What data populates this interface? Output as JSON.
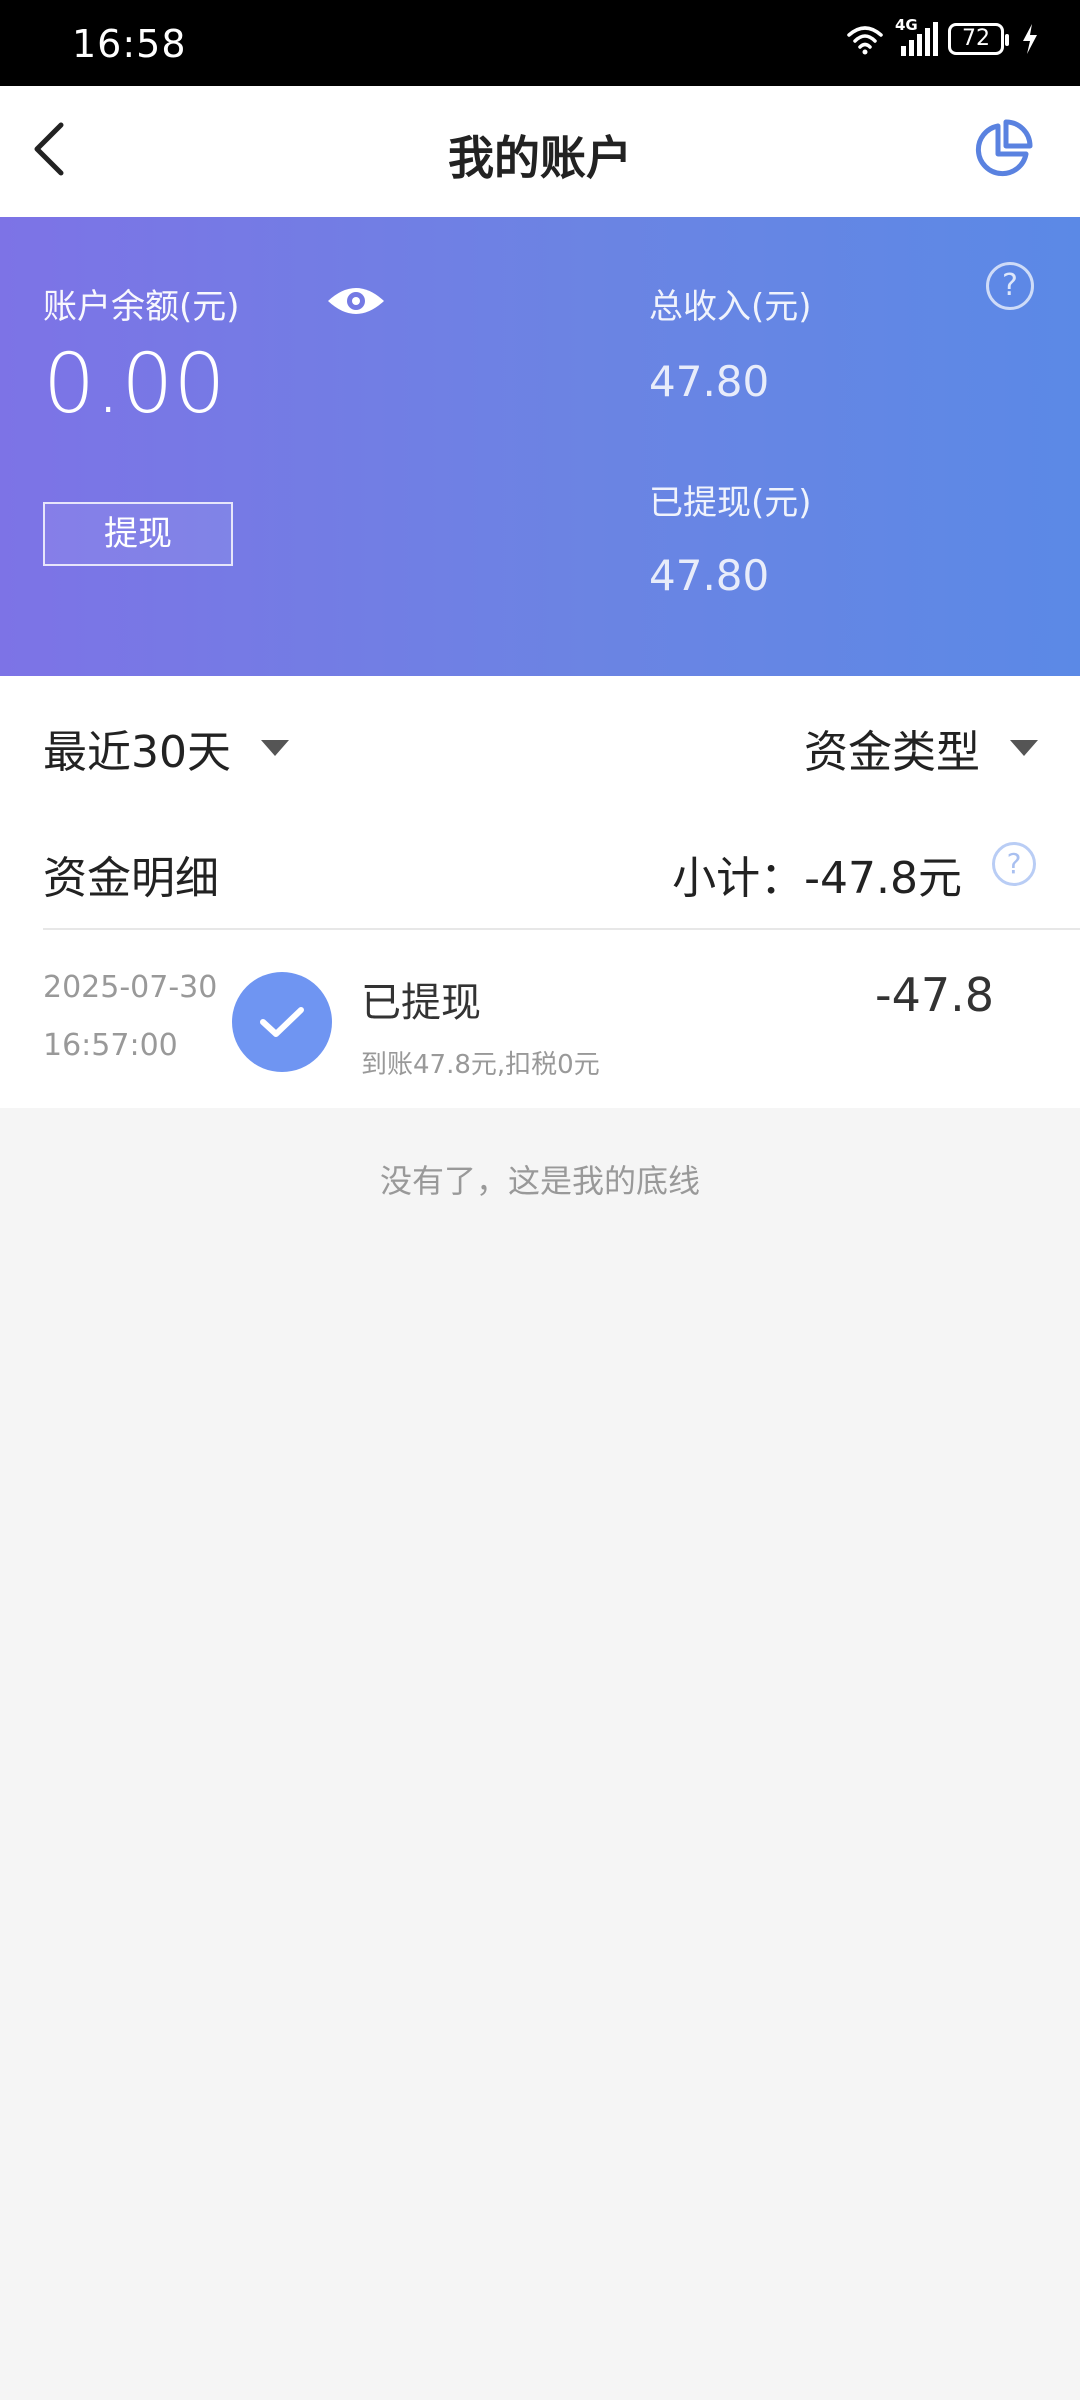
{
  "status_bar": {
    "time": "16:58",
    "network": "4G",
    "battery": "72",
    "icons": [
      "wifi-icon",
      "signal-icon",
      "battery-icon",
      "charging-icon"
    ]
  },
  "nav": {
    "title": "我的账户",
    "back_icon": "back-arrow-icon",
    "chart_icon": "pie-chart-icon"
  },
  "header": {
    "balance_label": "账户余额(元)",
    "balance_value": "0.00",
    "withdraw_button": "提现",
    "total_income_label": "总收入(元)",
    "total_income_value": "47.80",
    "withdrawn_label": "已提现(元)",
    "withdrawn_value": "47.80",
    "help_icon": "?",
    "gradient_start": "#7d73e6",
    "gradient_end": "#5b89e6"
  },
  "filters": {
    "date_range": "最近30天",
    "fund_type": "资金类型"
  },
  "details": {
    "title": "资金明细",
    "subtotal": "小计：-47.8元",
    "help_icon": "?",
    "records": [
      {
        "date": "2025-07-30",
        "time": "16:57:00",
        "title": "已提现",
        "subtitle": "到账47.8元,扣税0元",
        "amount": "-47.8",
        "icon": "check-icon"
      }
    ]
  },
  "footer_note": "没有了，这是我的底线",
  "colors": {
    "accent": "#6f95f2",
    "background": "#f5f5f5"
  }
}
